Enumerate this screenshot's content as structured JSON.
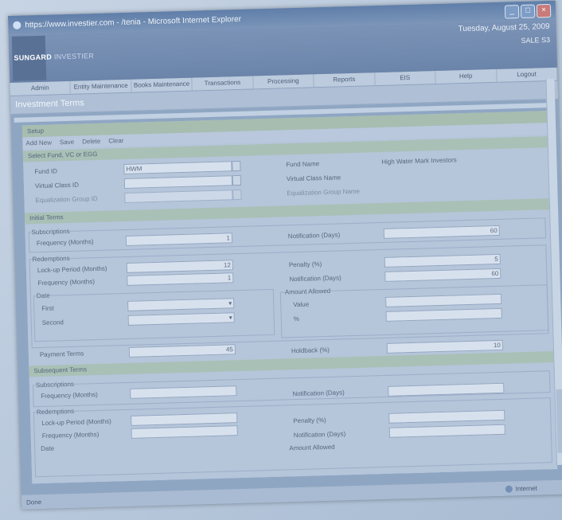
{
  "window": {
    "title": "https://www.investier.com - /tenia - Microsoft Internet Explorer"
  },
  "banner": {
    "logo_bold": "SUNGARD",
    "logo_rest": " INVESTIER",
    "date": "Tuesday, August 25, 2009",
    "user": "SALE S3"
  },
  "menu": [
    "Admin",
    "Entity Maintenance",
    "Books Maintenance",
    "Transactions",
    "Processing",
    "Reports",
    "EIS",
    "Help",
    "Logout"
  ],
  "page_title": "Investment Terms",
  "setup": {
    "header": "Setup",
    "actions": [
      "Add New",
      "Save",
      "Delete",
      "Clear"
    ]
  },
  "select_fund": {
    "header": "Select Fund, VC or EGG",
    "fund_id_label": "Fund ID",
    "fund_id_value": "HWM",
    "virtual_class_label": "Virtual Class ID",
    "equalization_label": "Equalization Group ID",
    "fund_name_label": "Fund Name",
    "fund_name_value": "High Water Mark Investors",
    "virtual_class_name_label": "Virtual Class Name",
    "equalization_name_label": "Equalization Group Name"
  },
  "initial": {
    "header": "Initial Terms",
    "subs_legend": "Subscriptions",
    "frequency_label": "Frequency (Months)",
    "frequency_value": "1",
    "notification_label": "Notification (Days)",
    "notification_value": "60",
    "red_legend": "Redemptions",
    "lockup_label": "Lock-up Period (Months)",
    "lockup_value": "12",
    "red_frequency_value": "1",
    "penalty_label": "Penalty (%)",
    "penalty_value": "5",
    "red_notification_value": "60",
    "date_legend": "Date",
    "first_label": "First",
    "second_label": "Second",
    "amount_legend": "Amount Allowed",
    "value_label": "Value",
    "pct_label": "%",
    "payment_label": "Payment Terms",
    "payment_value": "45",
    "holdback_label": "Holdback (%)",
    "holdback_value": "10"
  },
  "subsequent": {
    "header": "Subsequent Terms",
    "subs_legend": "Subscriptions",
    "frequency_label": "Frequency (Months)",
    "notification_label": "Notification (Days)",
    "red_legend": "Redemptions",
    "lockup_label": "Lock-up Period (Months)",
    "penalty_label": "Penalty (%)",
    "red_frequency_label": "Frequency (Months)",
    "red_notification_label": "Notification (Days)",
    "date_legend": "Date",
    "amount_legend": "Amount Allowed"
  },
  "status": {
    "left": "Done",
    "zone": "Internet"
  }
}
